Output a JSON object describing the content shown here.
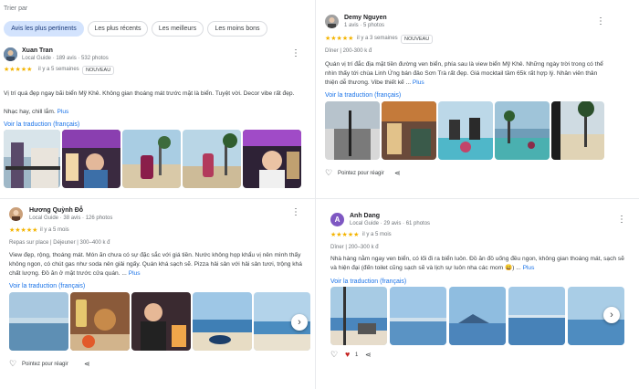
{
  "sort": {
    "label": "Trier par",
    "chips": [
      "Avis les plus pertinents",
      "Les plus récents",
      "Les meilleurs",
      "Les moins bons"
    ]
  },
  "reviews": [
    {
      "name": "Xuan Tran",
      "meta": "Local Guide · 189 avis · 532 photos",
      "stars": "★★★★★",
      "when": "il y a 5 semaines",
      "badge": "NOUVEAU",
      "text": "Vị trí quá đẹp ngay bãi biển Mỹ Khê. Không gian thoáng mát trước mặt là biển. Tuyệt vời. Decor vibe rất đẹp.",
      "text2": "Nhạc hay, chill lắm.",
      "more": "Plus",
      "translate": "Voir la traduction (français)"
    },
    {
      "name": "Demy Nguyen",
      "meta": "1 avis · 5 photos",
      "stars": "★★★★★",
      "when": "il y a 3 semaines",
      "badge": "NOUVEAU",
      "tags": "Dîner | 200-300 k đ",
      "text": "Quán vị trí đắc địa mặt tiền đường ven biển, phía sau là view biển Mỹ Khê. Những ngày trời trong có thể nhìn thấy tới chùa Linh Ứng bán đảo Sơn Trà rất đẹp. Giá mocktail tầm 65k rất hợp lý. Nhân viên thân thiện dễ thương. Vibe thiết kế ...",
      "more": "Plus",
      "translate": "Voir la traduction (français)",
      "like": "Pointez pour réagir"
    },
    {
      "name": "Hương Quỳnh Đỗ",
      "meta": "Local Guide · 38 avis · 126 photos",
      "stars": "★★★★★",
      "when": "il y a 5 mois",
      "tags": "Repas sur place | Déjeuner | 300–400 k đ",
      "text": "View đẹp, rộng, thoáng mát. Món ăn chưa có sự đặc sắc với giá tiền. Nước không họp khẩu vị nên mình thấy không ngon, có chút gas như soda nên giải ngấy. Quán khá sạch sẽ. Pizza hải sản với hải sản tươi, trộng khá chất lượng. Đồ ăn ở mặt trước cửa quán. ...",
      "more": "Plus",
      "translate": "Voir la traduction (français)",
      "like": "Pointez pour réagir"
    },
    {
      "name": "Anh Dang",
      "initial": "A",
      "meta": "Local Guide · 29 avis · 61 photos",
      "stars": "★★★★★",
      "when": "il y a 5 mois",
      "tags": "Dîner | 200–300 k đ",
      "text": "Nhà hàng nằm ngay ven biển, có lối đi ra biển luôn. Đồ ăn đồ uống đều ngon, không gian thoáng mát, sạch sẽ và hiện đại (đến toilet cũng sạch sẽ và lịch sự luôn nha các mom 😄) ...",
      "more": "Plus",
      "translate": "Voir la traduction (français)",
      "like_count": "1"
    }
  ],
  "icons": {
    "more": "more-vert-icon",
    "like": "heart-outline-icon",
    "share": "share-icon",
    "next": "chevron-right-icon"
  },
  "colors": {
    "accent": "#1a73e8",
    "star": "#f4b400",
    "chip_active": "#d3e3fd",
    "avatar_purple": "#7e57c2"
  }
}
